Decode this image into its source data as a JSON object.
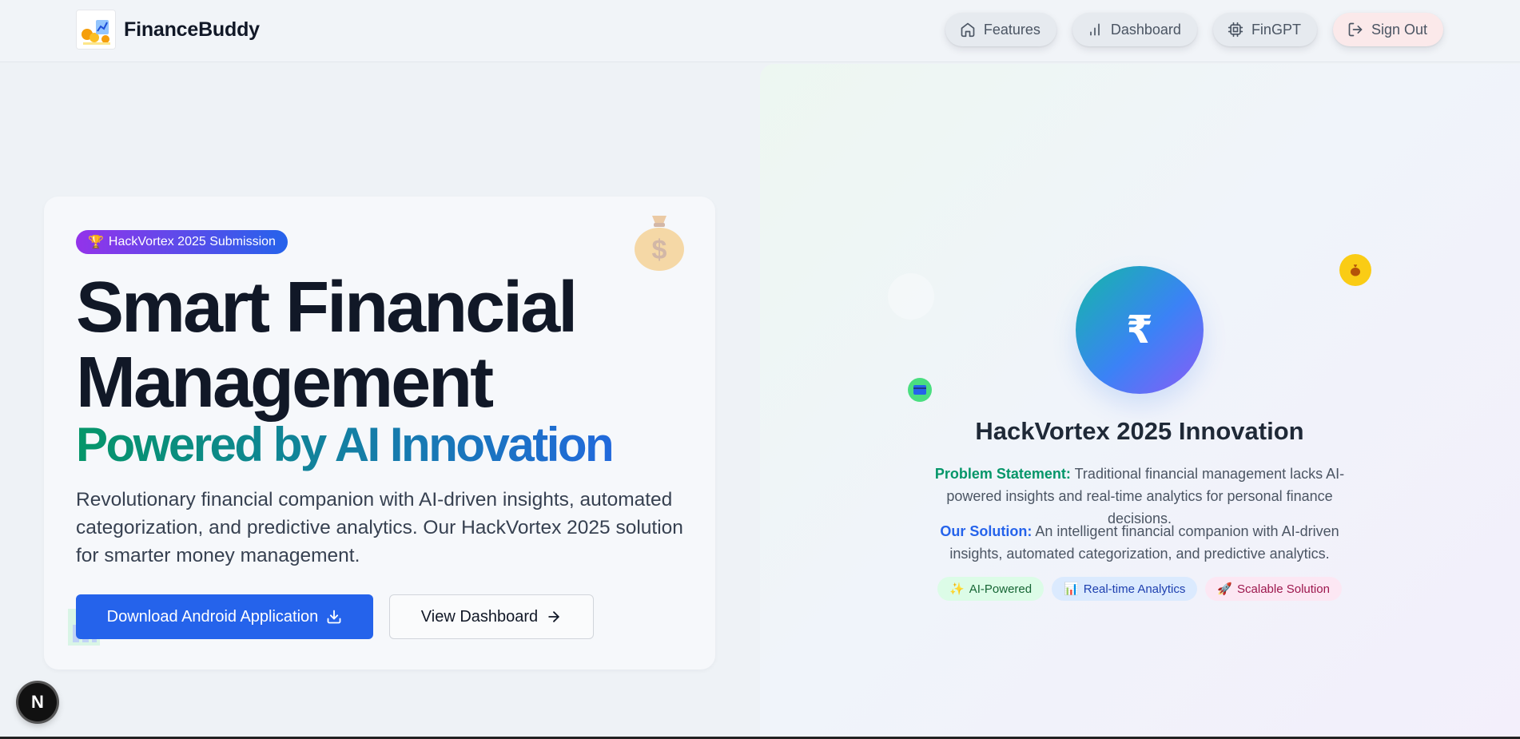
{
  "header": {
    "brand_name": "FinanceBuddy",
    "logo_icon": "finance-illustration-icon",
    "nav": [
      {
        "label": "Features",
        "icon": "home-icon"
      },
      {
        "label": "Dashboard",
        "icon": "bar-chart-icon"
      },
      {
        "label": "FinGPT",
        "icon": "cpu-icon"
      },
      {
        "label": "Sign Out",
        "icon": "log-out-icon"
      }
    ]
  },
  "hero": {
    "badge_icon": "🏆",
    "badge_text": "HackVortex 2025 Submission",
    "title_line1": "Smart Financial",
    "title_line2": "Management",
    "subtitle": "Powered by AI Innovation",
    "description": "Revolutionary financial companion with AI-driven insights, automated categorization, and predictive analytics. Our HackVortex 2025 solution for smarter money management.",
    "primary_button": "Download Android Application",
    "secondary_button": "View Dashboard",
    "decor_icon": "money-bag-icon"
  },
  "panel": {
    "center_symbol": "₹",
    "title": "HackVortex 2025 Innovation",
    "problem_label": "Problem Statement:",
    "problem_text": "Traditional financial management lacks AI-powered insights and real-time analytics for personal finance decisions.",
    "solution_label": "Our Solution:",
    "solution_text": "An intelligent financial companion with AI-driven insights, automated categorization, and predictive analytics.",
    "tags": [
      {
        "icon": "✨",
        "label": "AI-Powered"
      },
      {
        "icon": "📊",
        "label": "Real-time Analytics"
      },
      {
        "icon": "🚀",
        "label": "Scalable Solution"
      }
    ],
    "floating_icons": [
      "money-bag-icon",
      "credit-card-icon"
    ]
  },
  "dev_badge": {
    "label": "N"
  },
  "colors": {
    "primary": "#2563eb",
    "accent_green": "#059669",
    "badge_gradient_start": "#9333ea",
    "badge_gradient_end": "#2563eb",
    "text_dark": "#111827"
  }
}
